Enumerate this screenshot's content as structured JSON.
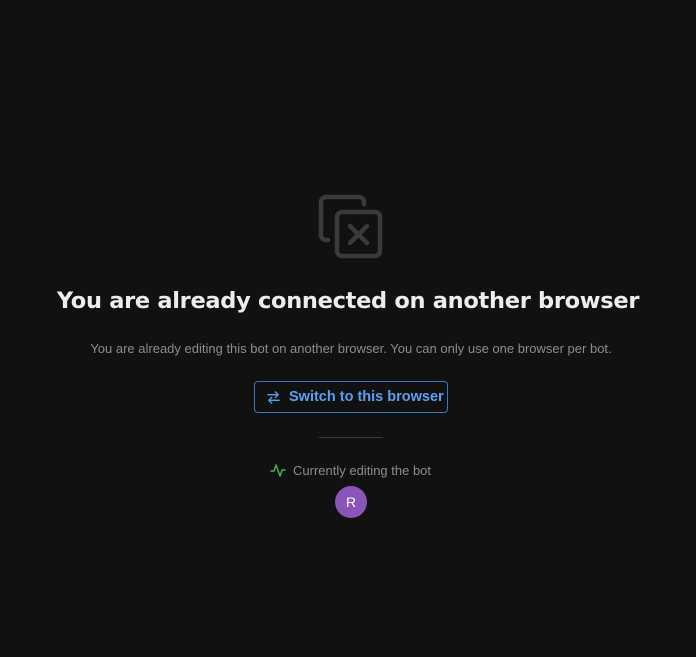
{
  "page": {
    "title": "You are already connected on another browser",
    "subtitle": "You are already editing this bot on another browser. You can only use one browser per bot.",
    "main_icon": "duplicate-x-icon"
  },
  "switch_button": {
    "label": "Switch to this browser",
    "icon": "arrows-left-right-icon",
    "color": "#5aa0f2"
  },
  "editing_status": {
    "label": "Currently editing the bot",
    "icon": "activity-pulse-icon",
    "icon_color": "#3fb950"
  },
  "avatar": {
    "initial": "R",
    "color": "#8a55b8"
  }
}
